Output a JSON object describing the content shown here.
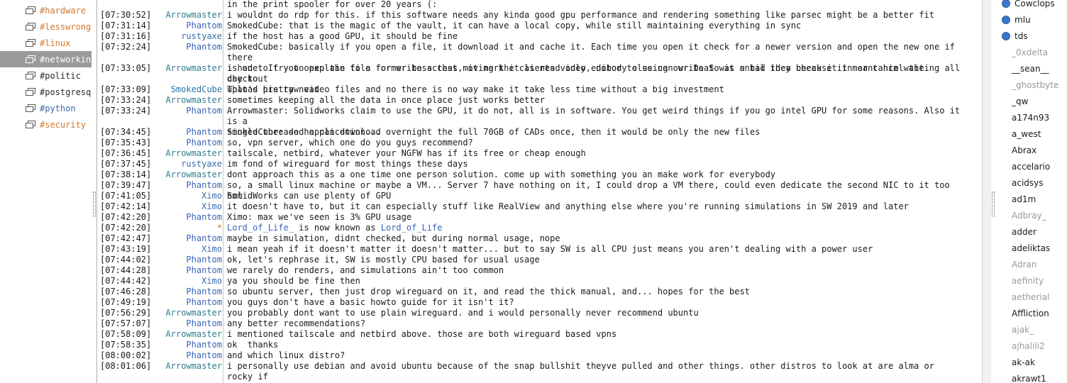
{
  "channels": [
    {
      "label": "#hardware",
      "state": "active"
    },
    {
      "label": "#lesswrong",
      "state": "active"
    },
    {
      "label": "#linux",
      "state": "active"
    },
    {
      "label": "#networking",
      "state": "selected"
    },
    {
      "label": "#politic",
      "state": "plain"
    },
    {
      "label": "#postgresql",
      "state": "plain"
    },
    {
      "label": "#python",
      "state": "link"
    },
    {
      "label": "#security",
      "state": "active"
    }
  ],
  "chat": {
    "lines": [
      {
        "time": "",
        "nick": "",
        "nick_class": "",
        "text": "in the print spooler for over 20 years (:"
      },
      {
        "time": "[07:30:52]",
        "nick": "Arrowmaster",
        "nick_class": "n-arrow",
        "text": "i wouldnt do rdp for this. if this software needs any kinda good gpu performance and rendering something like parsec might be a better fit"
      },
      {
        "time": "[07:31:14]",
        "nick": "Phantom",
        "nick_class": "n-phantom",
        "text": "SmokedCube: that is the magic of the vault, it can have a local copy, while still maintaining everything in sync"
      },
      {
        "time": "[07:31:16]",
        "nick": "rustyaxe",
        "nick_class": "n-rusty",
        "text": "if the host has a good GPU, it should be fine"
      },
      {
        "time": "[07:32:24]",
        "nick": "Phantom",
        "nick_class": "n-phantom",
        "text": "SmokedCube: basically if you open a file, it download it and cache it. Each time you open it check for a newer version and open the new one if there\nis one. If you open the file for write access, it mark it as read only, nobody else can write to it until they check it in or cancel the checkout"
      },
      {
        "time": "[07:33:05]",
        "nick": "Arrowmaster",
        "nick_class": "n-arrow",
        "text": "i had to try to explain to a former boss that moving the clients video editor to using our DaaS was a bad idea because it meant him waiting all day to\nupload his raw video files and no there is no way make it take less time without a big investment"
      },
      {
        "time": "[07:33:09]",
        "nick": "SmokedCube",
        "nick_class": "n-smoked",
        "text": "That's pretty neat"
      },
      {
        "time": "[07:33:24]",
        "nick": "Arrowmaster",
        "nick_class": "n-arrow",
        "text": "sometimes keeping all the data in once place just works better"
      },
      {
        "time": "[07:33:24]",
        "nick": "Phantom",
        "nick_class": "n-phantom",
        "text": "Arrowmaster: Solidworks claim to use the GPU, it do not, all is in software. You get weird things if you go intel GPU for some reasons. Also it is a\nsingle threaded application..."
      },
      {
        "time": "[07:34:45]",
        "nick": "Phantom",
        "nick_class": "n-phantom",
        "text": "SmokedCube: so he can download overnight the full 70GB of CADs once, then it would be only the new files"
      },
      {
        "time": "[07:35:43]",
        "nick": "Phantom",
        "nick_class": "n-phantom",
        "text": "so, vpn server, which one do you guys recommend?"
      },
      {
        "time": "[07:36:45]",
        "nick": "Arrowmaster",
        "nick_class": "n-arrow",
        "text": "tailscale, netbird, whatever your NGFW has if its free or cheap enough"
      },
      {
        "time": "[07:37:45]",
        "nick": "rustyaxe",
        "nick_class": "n-rusty",
        "text": "im fond of wireguard for most things these days"
      },
      {
        "time": "[07:38:14]",
        "nick": "Arrowmaster",
        "nick_class": "n-arrow",
        "text": "dont approach this as a one time one person solution. come up with something you an make work for everybody"
      },
      {
        "time": "[07:39:47]",
        "nick": "Phantom",
        "nick_class": "n-phantom",
        "text": "so, a small linux machine or maybe a VM... Server 7 have nothing on it, I could drop a VM there, could even dedicate the second NIC to it too hmm"
      },
      {
        "time": "[07:41:05]",
        "nick": "Ximo",
        "nick_class": "n-ximo",
        "text": "SolidWorks can use plenty of GPU"
      },
      {
        "time": "[07:42:14]",
        "nick": "Ximo",
        "nick_class": "n-ximo",
        "text": "it doesn't have to, but it can especially stuff like RealView and anything else where you're running simulations in SW 2019 and later"
      },
      {
        "time": "[07:42:20]",
        "nick": "Phantom",
        "nick_class": "n-phantom",
        "text": "Ximo: max we've seen is 3% GPU usage"
      },
      {
        "time": "[07:42:20]",
        "nick": "*",
        "nick_class": "n-star",
        "text": "",
        "rename": {
          "old": "Lord_of_Life_",
          "mid": " is now known as ",
          "new": "Lord_of_Life"
        }
      },
      {
        "time": "[07:42:47]",
        "nick": "Phantom",
        "nick_class": "n-phantom",
        "text": "maybe in simulation, didnt checked, but during normal usage, nope"
      },
      {
        "time": "[07:43:19]",
        "nick": "Ximo",
        "nick_class": "n-ximo",
        "text": "i mean yeah if it doesn't matter it doesn't matter... but to say SW is all CPU just means you aren't dealing with a power user"
      },
      {
        "time": "[07:44:02]",
        "nick": "Phantom",
        "nick_class": "n-phantom",
        "text": "ok, let's rephrase it, SW is mostly CPU based for usual usage"
      },
      {
        "time": "[07:44:28]",
        "nick": "Phantom",
        "nick_class": "n-phantom",
        "text": "we rarely do renders, and simulations ain't too common"
      },
      {
        "time": "[07:44:42]",
        "nick": "Ximo",
        "nick_class": "n-ximo",
        "text": "ya you should be fine then"
      },
      {
        "time": "[07:46:28]",
        "nick": "Phantom",
        "nick_class": "n-phantom",
        "text": "so ubuntu server, then just drop wireguard on it, and read the thick manual, and... hopes for the best"
      },
      {
        "time": "[07:49:19]",
        "nick": "Phantom",
        "nick_class": "n-phantom",
        "text": "you guys don't have a basic howto guide for it isn't it?"
      },
      {
        "time": "[07:56:29]",
        "nick": "Arrowmaster",
        "nick_class": "n-arrow",
        "text": "you probably dont want to use plain wireguard. and i would personally never recommend ubuntu"
      },
      {
        "time": "[07:57:07]",
        "nick": "Phantom",
        "nick_class": "n-phantom",
        "text": "any better recommendations?"
      },
      {
        "time": "[07:58:09]",
        "nick": "Arrowmaster",
        "nick_class": "n-arrow",
        "text": "i mentioned tailscale and netbird above. those are both wireguard based vpns"
      },
      {
        "time": "[07:58:35]",
        "nick": "Phantom",
        "nick_class": "n-phantom",
        "text": "ok  thanks"
      },
      {
        "time": "[08:00:02]",
        "nick": "Phantom",
        "nick_class": "n-phantom",
        "text": "and which linux distro?"
      },
      {
        "time": "[08:01:06]",
        "nick": "Arrowmaster",
        "nick_class": "n-arrow",
        "text": "i personally use debian and avoid ubuntu because of the snap bullshit theyve pulled and other things. other distros to look at are alma or rocky if\nyou want a rhel like distro instead of debian like"
      }
    ]
  },
  "users": [
    {
      "name": "Cowclops",
      "mode": "op"
    },
    {
      "name": "mlu",
      "mode": "op"
    },
    {
      "name": "tds",
      "mode": "op"
    },
    {
      "name": "_0xdelta",
      "mode": "away"
    },
    {
      "name": "__sean__",
      "mode": "here"
    },
    {
      "name": "_ghostbyte",
      "mode": "away"
    },
    {
      "name": "_qw",
      "mode": "here"
    },
    {
      "name": "a174n93",
      "mode": "here"
    },
    {
      "name": "a_west",
      "mode": "here"
    },
    {
      "name": "Abrax",
      "mode": "here"
    },
    {
      "name": "accelario",
      "mode": "here"
    },
    {
      "name": "acidsys",
      "mode": "here"
    },
    {
      "name": "ad1m",
      "mode": "here"
    },
    {
      "name": "Adbray_",
      "mode": "away"
    },
    {
      "name": "adder",
      "mode": "here"
    },
    {
      "name": "adeliktas",
      "mode": "here"
    },
    {
      "name": "Adran",
      "mode": "away"
    },
    {
      "name": "aefinity",
      "mode": "away"
    },
    {
      "name": "aetherial",
      "mode": "away"
    },
    {
      "name": "Affliction",
      "mode": "here"
    },
    {
      "name": "ajak_",
      "mode": "away"
    },
    {
      "name": "ajhalili2",
      "mode": "away"
    },
    {
      "name": "ak-ak",
      "mode": "here"
    },
    {
      "name": "akrawt1",
      "mode": "here"
    }
  ]
}
